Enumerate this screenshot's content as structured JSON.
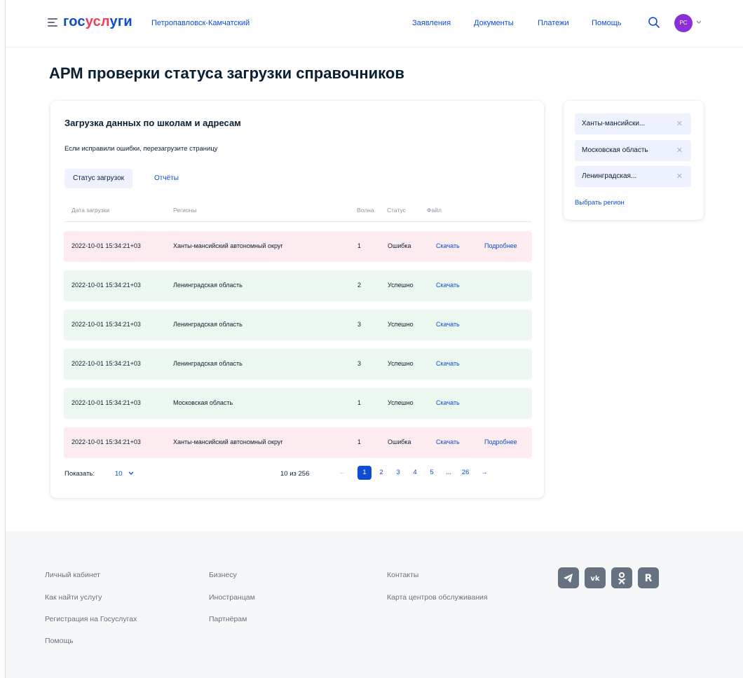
{
  "header": {
    "logo_part1": "гос",
    "logo_part2": "усл",
    "logo_part3": "уги",
    "city": "Петропавловск-Камчатский",
    "nav": [
      "Заявления",
      "Документы",
      "Платежи",
      "Помощь"
    ],
    "avatar_initials": "РС"
  },
  "page": {
    "title": "АРМ проверки статуса загрузки справочников"
  },
  "card": {
    "title": "Загрузка данных по школам и адресам",
    "subtitle": "Если исправили ошибки, перезагрузите страницу",
    "tab_active": "Статус загрузок",
    "tab_link": "Отчёты",
    "columns": [
      "Дата загрузки",
      "Регионы",
      "Волна",
      "Статус",
      "Файл"
    ],
    "rows": [
      {
        "date": "2022-10-01 15:34:21+03",
        "region": "Ханты-мансийский автономный округ",
        "wave": "1",
        "status": "Ошибка",
        "file": "Скачать",
        "details": "Подробнее",
        "state": "err"
      },
      {
        "date": "2022-10-01 15:34:21+03",
        "region": "Ленинградская область",
        "wave": "2",
        "status": "Успешно",
        "file": "Скачать",
        "details": "",
        "state": "ok"
      },
      {
        "date": "2022-10-01 15:34:21+03",
        "region": "Ленинградская область",
        "wave": "3",
        "status": "Успешно",
        "file": "Скачать",
        "details": "",
        "state": "ok"
      },
      {
        "date": "2022-10-01 15:34:21+03",
        "region": "Ленинградская область",
        "wave": "3",
        "status": "Успешно",
        "file": "Скачать",
        "details": "",
        "state": "ok"
      },
      {
        "date": "2022-10-01 15:34:21+03",
        "region": "Московская область",
        "wave": "1",
        "status": "Успешно",
        "file": "Скачать",
        "details": "",
        "state": "ok"
      },
      {
        "date": "2022-10-01 15:34:21+03",
        "region": "Ханты-мансийский автономный округ",
        "wave": "1",
        "status": "Ошибка",
        "file": "Скачать",
        "details": "Подробнее",
        "state": "err"
      }
    ],
    "show_label": "Показать:",
    "show_value": "10",
    "range_text": "10 из 256",
    "pages": [
      "1",
      "2",
      "3",
      "4",
      "5",
      "...",
      "26"
    ],
    "current_page": "1"
  },
  "side": {
    "chips": [
      "Ханты-мансийски...",
      "Московская область",
      "Ленинградская..."
    ],
    "link": "Выбрать регион"
  },
  "footer": {
    "col1": [
      "Личный кабинет",
      "Как найти услугу",
      "Регистрация на Госуслугах",
      "Помощь"
    ],
    "col2": [
      "Бизнесу",
      "Иностранцам",
      "Партнёрам"
    ],
    "col3": [
      "Контакты",
      "Карта центров обслуживания"
    ],
    "social": [
      "telegram-icon",
      "vk-icon",
      "odnoklassniki-icon",
      "rutube-icon"
    ]
  },
  "colors": {
    "brand_blue": "#0d4cd3",
    "brand_red": "#ee3f58",
    "error_row": "#fdecef",
    "success_row": "#ecf8ef",
    "avatar": "#8b2fd6"
  }
}
